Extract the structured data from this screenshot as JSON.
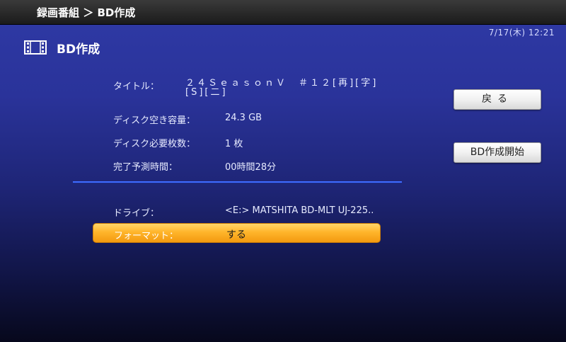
{
  "header": {
    "breadcrumb": "録画番組 ＞ BD作成"
  },
  "datetime": "7/17(木) 12:21",
  "page": {
    "title": "BD作成",
    "icon": "film-strip-icon"
  },
  "info": {
    "title_label": "タイトル：",
    "title_value": "２４ＳｅａｓｏｎＶ　＃１２[再][字][S][二]",
    "free_space_label": "ディスク空き容量：",
    "free_space_value": "24.3 GB",
    "discs_needed_label": "ディスク必要枚数：",
    "discs_needed_value": "1 枚",
    "estimated_time_label": "完了予測時間：",
    "estimated_time_value": "00時間28分"
  },
  "settings": {
    "drive_label": "ドライブ：",
    "drive_value": "<E:>  MATSHITA BD-MLT UJ-225..",
    "format_label": "フォーマット：",
    "format_value": "する"
  },
  "buttons": {
    "back": "戻る",
    "start": "BD作成開始"
  },
  "colors": {
    "accent_orange": "#ffb52b",
    "divider_blue": "#3f6cff",
    "background": "#2a339a"
  }
}
